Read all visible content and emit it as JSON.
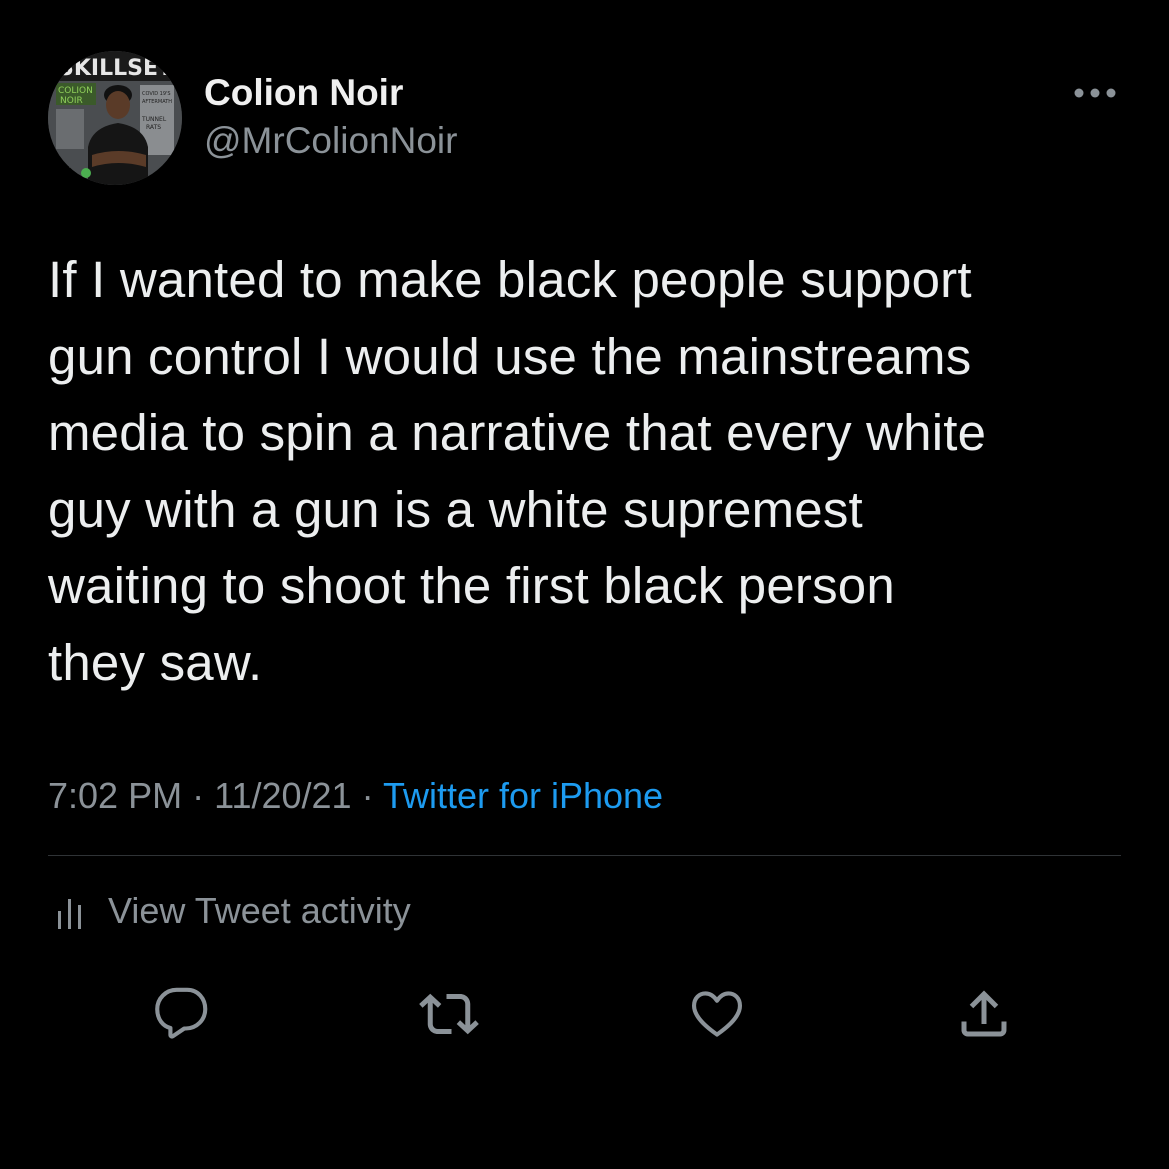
{
  "author": {
    "display_name": "Colion Noir",
    "handle": "@MrColionNoir",
    "avatar_icon": "magazine-cover-avatar",
    "avatar_cover_lettering": [
      "SKILLSET",
      "COLION NOIR",
      "COVID 19'S AFTERMATH",
      "TUNNEL RATS"
    ]
  },
  "tweet": {
    "text_lines": [
      "If I wanted to make black people support",
      "gun control I would use the mainstreams",
      "media to spin a narrative that every white",
      "guy with a gun is a white supremest",
      "waiting to shoot the first black person",
      "they saw."
    ],
    "time": "7:02 PM",
    "separator": "·",
    "date": "11/20/21",
    "source": "Twitter for iPhone"
  },
  "activity": {
    "label": "View Tweet activity",
    "icon": "bar-chart-icon"
  },
  "actions": {
    "reply_icon": "reply-icon",
    "retweet_icon": "retweet-icon",
    "like_icon": "heart-icon",
    "share_icon": "share-icon"
  },
  "colors": {
    "background": "#000000",
    "text": "#e7e9ea",
    "secondary_text": "#8b9298",
    "link": "#1d9bf0",
    "divider": "#2f3336"
  }
}
